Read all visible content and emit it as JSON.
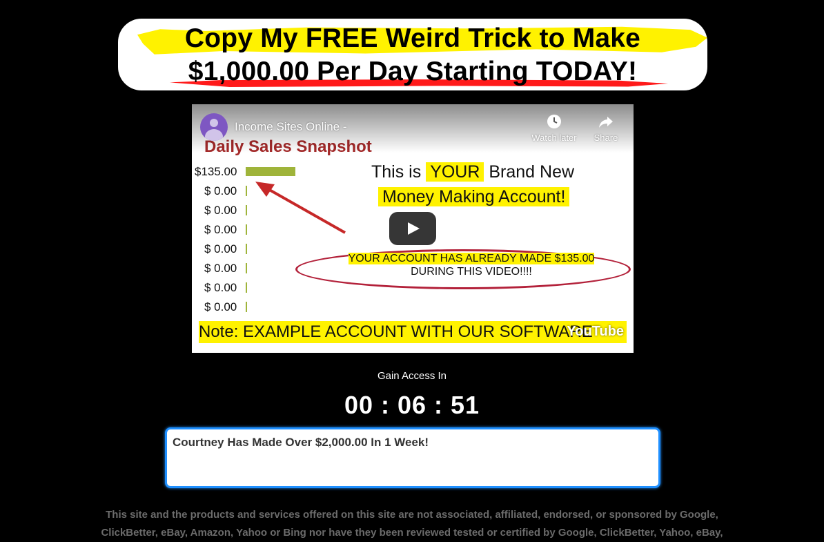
{
  "headline": {
    "line1": "Copy My FREE Weird Trick to Make",
    "line2": "$1,000.00 Per Day Starting TODAY!"
  },
  "video": {
    "channel_title": "Income Sites Online -",
    "watch_later_label": "Watch later",
    "share_label": "Share",
    "thumbnail": {
      "title": "Daily Sales Snapshot",
      "rows": [
        {
          "amount": "$135.00"
        },
        {
          "amount": "$ 0.00"
        },
        {
          "amount": "$ 0.00"
        },
        {
          "amount": "$ 0.00"
        },
        {
          "amount": "$ 0.00"
        },
        {
          "amount": "$ 0.00"
        },
        {
          "amount": "$ 0.00"
        },
        {
          "amount": "$ 0.00"
        }
      ],
      "promo_line1_pre": "This is ",
      "promo_line1_highlight": "YOUR",
      "promo_line1_post": " Brand New",
      "promo_line2": "Money Making Account!",
      "ellipse_text_line1": "YOUR ACCOUNT HAS ALREADY MADE $135.00",
      "ellipse_text_line2": "DURING THIS VIDEO!!!!",
      "note": "Note: EXAMPLE ACCOUNT WITH OUR SOFTWARE"
    },
    "youtube_logo": "YouTube"
  },
  "access": {
    "label": "Gain Access In",
    "countdown": "00 : 06 : 51"
  },
  "ticker": {
    "text": "Courtney Has Made Over $2,000.00 In 1 Week!"
  },
  "disclaimer": {
    "text": "This site and the products and services offered on this site are not associated, affiliated, endorsed, or sponsored by Google, ClickBetter, eBay, Amazon, Yahoo or Bing nor have they been reviewed tested or certified by Google, ClickBetter, Yahoo, eBay,"
  },
  "colors": {
    "background": "#000000",
    "highlight_yellow": "#fff200",
    "underline_red": "#ff1a1a",
    "ticker_border": "#1e8fff"
  }
}
